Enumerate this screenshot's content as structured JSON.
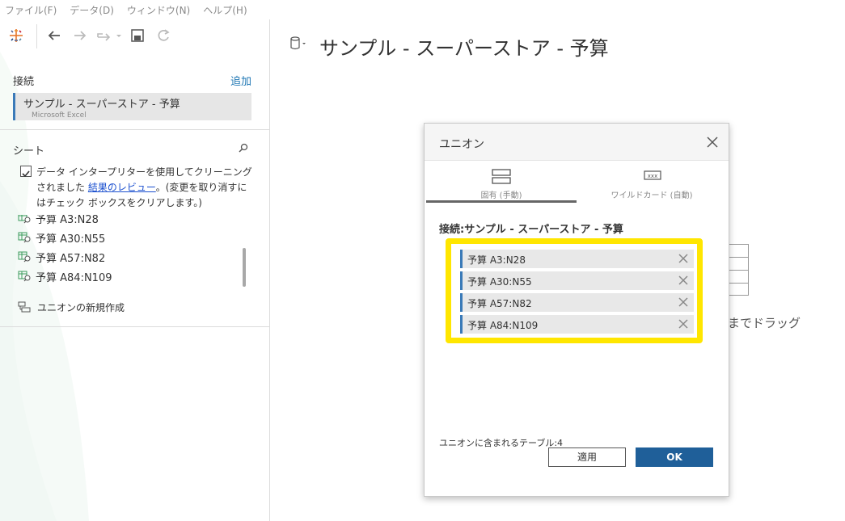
{
  "menu": [
    "ファイル(F)",
    "データ(D)",
    "ウィンドウ(N)",
    "ヘルプ(H)"
  ],
  "left": {
    "connections_label": "接続",
    "add_label": "追加",
    "connection": {
      "name": "サンプル - スーパーストア - 予算",
      "type": "Microsoft Excel"
    },
    "sheets_label": "シート",
    "interpreter": {
      "text": "データ インタープリターを使用してクリーニングされました",
      "link": "結果のレビュー",
      "suffix": "。(変更を取り消すにはチェック ボックスをクリアします。)",
      "checked": true
    },
    "sheets": [
      "予算 A3:N28",
      "予算 A30:N55",
      "予算 A57:N82",
      "予算 A84:N109"
    ],
    "new_union": "ユニオンの新規作成"
  },
  "main": {
    "title": "サンプル - スーパーストア - 予算",
    "drag_text_fragment": "までドラッグ"
  },
  "dialog": {
    "title": "ユニオン",
    "tabs": [
      {
        "label": "固有 (手動)",
        "active": true
      },
      {
        "label": "ワイルドカード (自動)",
        "active": false
      }
    ],
    "connection": "接続:サンプル - スーパーストア - 予算",
    "tables": [
      "予算 A3:N28",
      "予算 A30:N55",
      "予算 A57:N82",
      "予算 A84:N109"
    ],
    "count_text": "ユニオンに含まれるテーブル:4",
    "apply_label": "適用",
    "ok_label": "OK"
  },
  "colors": {
    "accent": "#1f5f99",
    "highlight": "#ffe600",
    "link": "#1f77b4"
  }
}
